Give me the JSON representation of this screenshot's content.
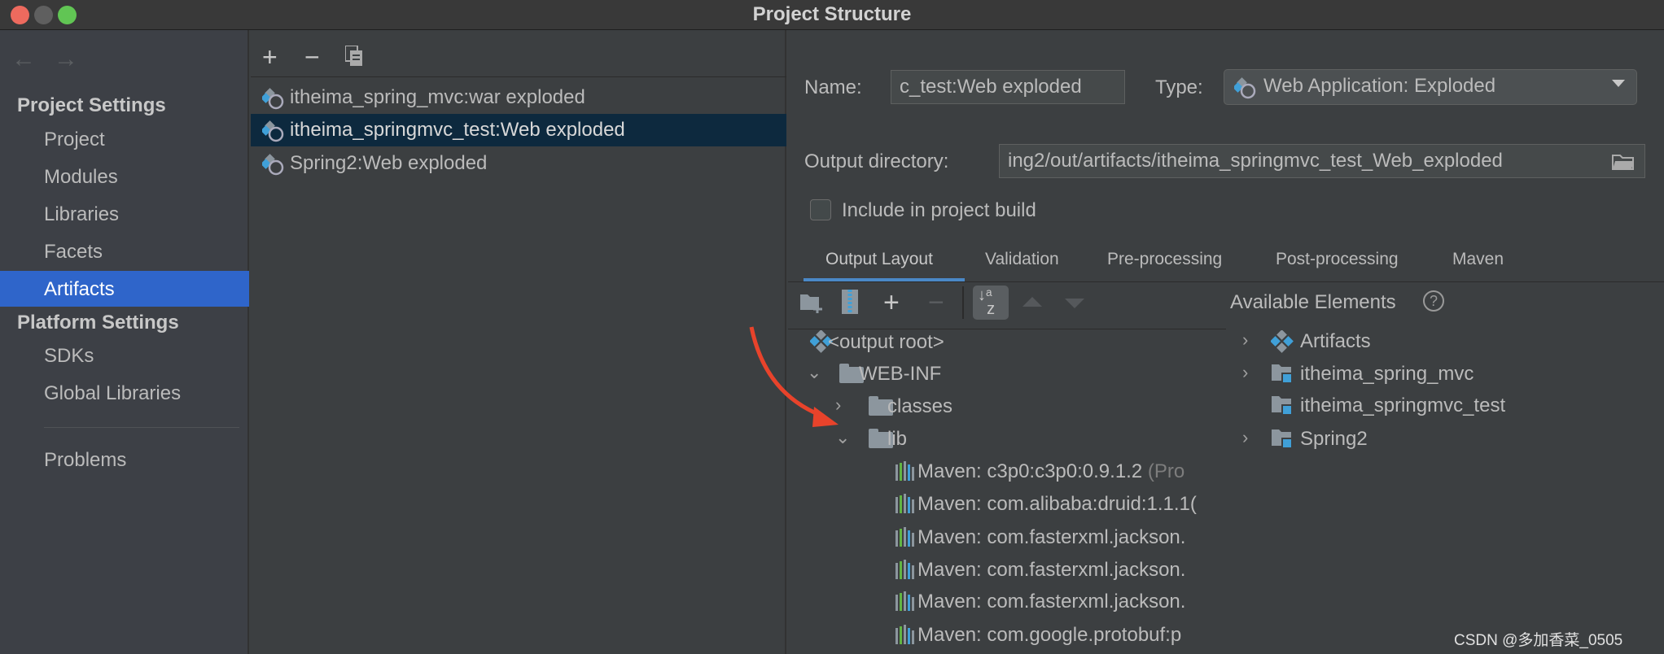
{
  "window": {
    "title": "Project Structure"
  },
  "sidebar": {
    "project_settings_header": "Project Settings",
    "project_items": [
      {
        "label": "Project"
      },
      {
        "label": "Modules"
      },
      {
        "label": "Libraries"
      },
      {
        "label": "Facets"
      },
      {
        "label": "Artifacts",
        "selected": true
      }
    ],
    "platform_settings_header": "Platform Settings",
    "platform_items": [
      {
        "label": "SDKs"
      },
      {
        "label": "Global Libraries"
      }
    ],
    "problems": "Problems",
    "selected_color": "#2f65ca"
  },
  "artifacts_list": {
    "items": [
      {
        "label": "itheima_spring_mvc:war exploded"
      },
      {
        "label": "itheima_springmvc_test:Web exploded",
        "selected": true
      },
      {
        "label": "Spring2:Web exploded"
      }
    ]
  },
  "details": {
    "name_label": "Name:",
    "name_value": "c_test:Web exploded",
    "type_label": "Type:",
    "type_value": "Web Application: Exploded",
    "output_dir_label": "Output directory:",
    "output_dir_value": "ing2/out/artifacts/itheima_springmvc_test_Web_exploded",
    "include_label": "Include in project build",
    "include_checked": false,
    "tabs": [
      {
        "label": "Output Layout",
        "active": true
      },
      {
        "label": "Validation"
      },
      {
        "label": "Pre-processing"
      },
      {
        "label": "Post-processing"
      },
      {
        "label": "Maven"
      }
    ]
  },
  "output_tree": [
    {
      "label": "<output root>",
      "icon": "artifact-icon"
    },
    {
      "label": "WEB-INF",
      "icon": "folder-icon",
      "expanded": true
    },
    {
      "label": "classes",
      "icon": "folder-icon",
      "expanded": false
    },
    {
      "label": "lib",
      "icon": "folder-icon",
      "expanded": true
    },
    {
      "label": "Maven: c3p0:c3p0:0.9.1.2",
      "suffix": "(Pro",
      "icon": "maven-library-icon"
    },
    {
      "label": "Maven: com.alibaba:druid:1.1.1(",
      "icon": "maven-library-icon"
    },
    {
      "label": "Maven: com.fasterxml.jackson.",
      "icon": "maven-library-icon"
    },
    {
      "label": "Maven: com.fasterxml.jackson.",
      "icon": "maven-library-icon"
    },
    {
      "label": "Maven: com.fasterxml.jackson.",
      "icon": "maven-library-icon"
    },
    {
      "label": "Maven: com.google.protobuf:p",
      "icon": "maven-library-icon"
    }
  ],
  "available": {
    "title": "Available Elements",
    "items": [
      {
        "label": "Artifacts"
      },
      {
        "label": "itheima_spring_mvc"
      },
      {
        "label": "itheima_springmvc_test"
      },
      {
        "label": "Spring2"
      }
    ]
  },
  "watermark": "CSDN @多加香菜_0505"
}
